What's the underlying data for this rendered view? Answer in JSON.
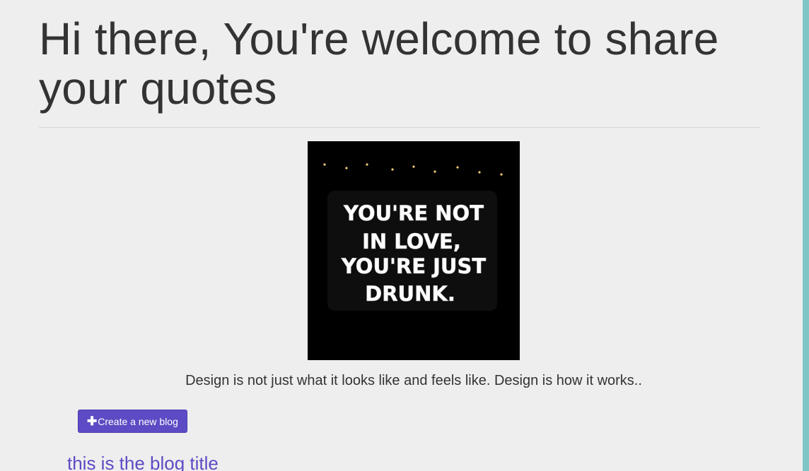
{
  "header": {
    "title": "Hi there, You're welcome to share your quotes"
  },
  "hero": {
    "image_alt": "Neon sign quote",
    "neon_lines": [
      "YOU'RE NOT",
      "IN LOVE,",
      "YOU'RE JUST",
      "DRUNK."
    ]
  },
  "quote": {
    "text": "Design is not just what it looks like and feels like. Design is how it works.."
  },
  "actions": {
    "create_label": "Create a new blog",
    "create_icon": "plus-icon"
  },
  "blog": {
    "first_title": "this is the blog title"
  },
  "colors": {
    "background": "#eeeeee",
    "accent": "#5c4bc4",
    "right_strip": "#7fc7c6",
    "text": "#333333"
  }
}
